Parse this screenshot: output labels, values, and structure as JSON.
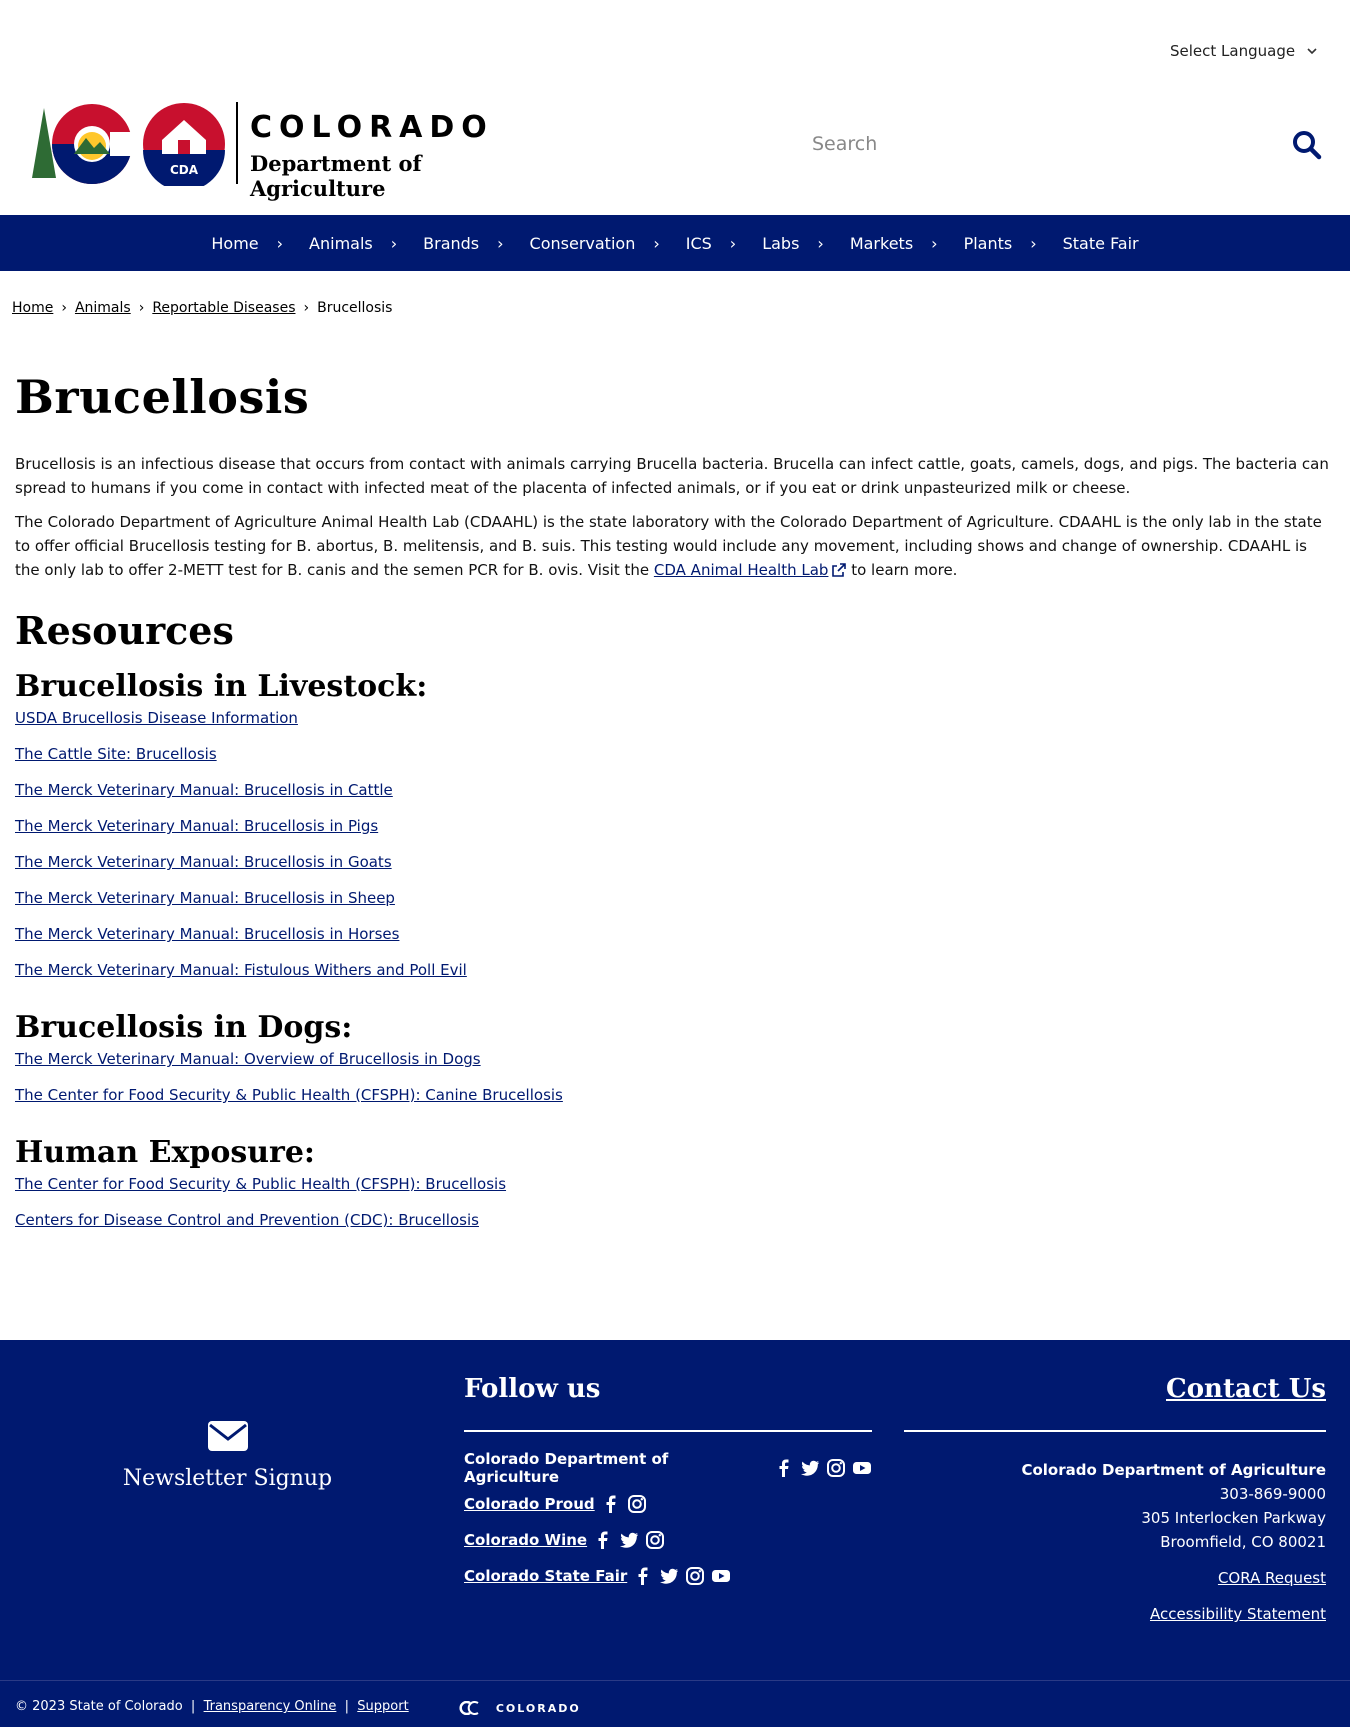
{
  "language": {
    "label": "Select Language"
  },
  "logo": {
    "state": "COLORADO",
    "dept": "Department of Agriculture",
    "badge": "CDA"
  },
  "search": {
    "placeholder": "Search"
  },
  "nav": [
    "Home",
    "Animals",
    "Brands",
    "Conservation",
    "ICS",
    "Labs",
    "Markets",
    "Plants",
    "State Fair"
  ],
  "breadcrumb": [
    "Home",
    "Animals",
    "Reportable Diseases",
    "Brucellosis"
  ],
  "page": {
    "title": "Brucellosis",
    "para1": "Brucellosis is an infectious disease that occurs from contact with animals carrying Brucella bacteria. Brucella can infect cattle, goats, camels, dogs, and pigs. The bacteria can spread to humans if you come in contact with infected meat of the placenta of infected animals, or if you eat or drink unpasteurized milk or cheese.",
    "para2_before": "The Colorado Department of Agriculture Animal Health Lab (CDAAHL) is the state laboratory with the Colorado Department of Agriculture. CDAAHL is the only lab in the state to offer official Brucellosis testing for B. abortus, B. melitensis, and B. suis. This testing would include any movement, including shows and change of ownership. CDAAHL is the only lab to offer 2-METT test for B. canis and the semen PCR for B. ovis. Visit the ",
    "para2_link": "CDA Animal Health Lab",
    "para2_after": " to learn more.",
    "resources_heading": "Resources"
  },
  "livestock": {
    "heading": "Brucellosis in Livestock:",
    "links": [
      "USDA Brucellosis Disease Information",
      "The Cattle Site: Brucellosis",
      "The Merck Veterinary Manual: Brucellosis in Cattle",
      "The Merck Veterinary Manual: Brucellosis in Pigs",
      "The Merck Veterinary Manual: Brucellosis in Goats",
      "The Merck Veterinary Manual: Brucellosis in Sheep",
      "The Merck Veterinary Manual: Brucellosis in Horses",
      "The Merck Veterinary Manual: Fistulous Withers and Poll Evil"
    ]
  },
  "dogs": {
    "heading": "Brucellosis in Dogs:",
    "links": [
      "The Merck Veterinary Manual: Overview of Brucellosis in Dogs",
      "The Center for Food Security & Public Health (CFSPH): Canine Brucellosis"
    ]
  },
  "human": {
    "heading": "Human Exposure:",
    "links": [
      "The Center for Food Security & Public Health (CFSPH): Brucellosis",
      "Centers for Disease Control and Prevention (CDC): Brucellosis"
    ]
  },
  "footer": {
    "newsletter": "Newsletter Signup",
    "follow_heading": "Follow us",
    "social": [
      {
        "name": "Colorado Department of Agriculture",
        "icons": [
          "facebook-icon",
          "twitter-icon",
          "instagram-icon",
          "youtube-icon"
        ]
      },
      {
        "name": "Colorado Proud",
        "icons": [
          "facebook-icon",
          "instagram-icon"
        ]
      },
      {
        "name": "Colorado Wine",
        "icons": [
          "facebook-icon",
          "twitter-icon",
          "instagram-icon"
        ]
      },
      {
        "name": "Colorado State Fair",
        "icons": [
          "facebook-icon",
          "twitter-icon",
          "instagram-icon",
          "youtube-icon"
        ]
      }
    ],
    "contact_heading": "Contact Us",
    "org": "Colorado Department of Agriculture",
    "phone": "303-869-9000",
    "address1": "305 Interlocken Parkway",
    "address2": "Broomfield, CO 80021",
    "cora": "CORA Request",
    "accessibility": "Accessibility Statement",
    "copyright": "© 2023 State of Colorado",
    "transparency": "Transparency Online",
    "support": "Support",
    "brand": "COLORADO"
  },
  "colors": {
    "navy": "#001970",
    "red": "#c8102e",
    "gold": "#ffc72c",
    "green": "#2e6b34"
  }
}
